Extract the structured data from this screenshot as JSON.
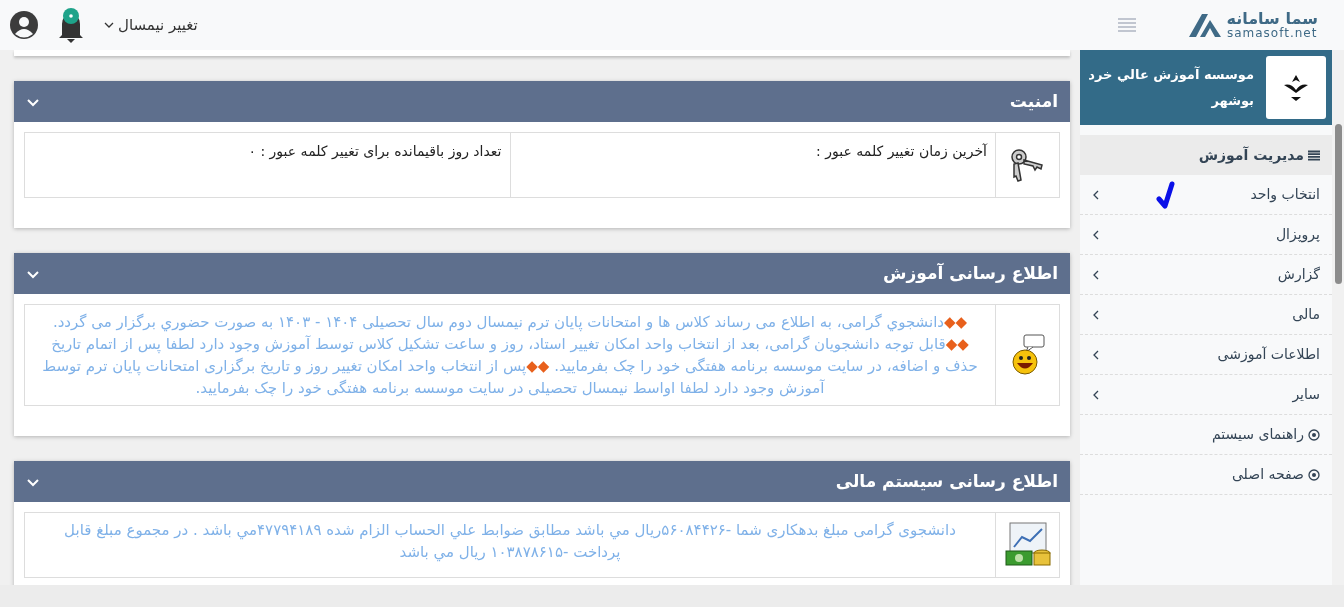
{
  "header": {
    "logo_name": "سما سامانه",
    "logo_domain": "samasoft.net",
    "semester_menu": "تغییر نیمسال"
  },
  "sidebar": {
    "institute": "موسسه آموزش عالي خرد بوشهر",
    "section": {
      "title": "مدیریت آموزش",
      "expanded": true
    },
    "items": [
      {
        "label": "انتخاب واحد",
        "kind": "submenu",
        "ticked": true
      },
      {
        "label": "پروپزال",
        "kind": "submenu",
        "ticked": false
      },
      {
        "label": "گزارش",
        "kind": "submenu",
        "ticked": false
      },
      {
        "label": "مالی",
        "kind": "submenu",
        "ticked": false
      },
      {
        "label": "اطلاعات آموزشی",
        "kind": "submenu",
        "ticked": false
      },
      {
        "label": "سایر",
        "kind": "submenu",
        "ticked": false
      },
      {
        "label": "راهنمای سیستم",
        "kind": "link",
        "ticked": false
      },
      {
        "label": "صفحه اصلی",
        "kind": "link",
        "ticked": false
      }
    ]
  },
  "cards": [
    {
      "title": "امنیت",
      "kind": "security",
      "expanded": true,
      "cells": [
        "آخرین زمان تغییر کلمه عبور :",
        "تعداد روز باقیمانده برای تغییر کلمه عبور : ۰"
      ]
    },
    {
      "title": "اطلاع رسانی آموزش",
      "kind": "education",
      "expanded": true,
      "marker": "◆◆",
      "notices": [
        "دانشجوي گرامی، به اطلاع می رساند کلاس ها و امتحانات پایان ترم نیمسال دوم سال تحصیلی ۱۴۰۴ - ۱۴۰۳ به صورت حضوري برگزار می گردد.",
        "قابل توجه دانشجویان گرامی، بعد از انتخاب واحد امکان تغییر استاد، روز و ساعت تشکیل کلاس توسط آموزش وجود دارد لطفا پس از اتمام تاریخ حذف و اضافه، در سایت موسسه برنامه هفتگی خود را چک بفرمایید.",
        "پس از انتخاب واحد امکان تغییر روز و تاریخ برگزاری امتحانات پایان ترم توسط آموزش وجود دارد لطفا اواسط نیمسال تحصیلی در سایت موسسه برنامه هفتگی خود را چک بفرمایید."
      ]
    },
    {
      "title": "اطلاع رسانی سیستم مالی",
      "kind": "finance",
      "expanded": true,
      "notices": [
        "دانشجوی گرامی مبلغ بدهکاری شما -۵۶۰۸۴۴۲۶ریال مي باشد مطابق ضوابط علي الحساب الزام شده ۴۷۷۹۴۱۸۹مي باشد . در مجموع مبلغ قابل پرداخت -۱۰۳۸۷۸۶۱۵ ریال مي باشد"
      ]
    }
  ]
}
